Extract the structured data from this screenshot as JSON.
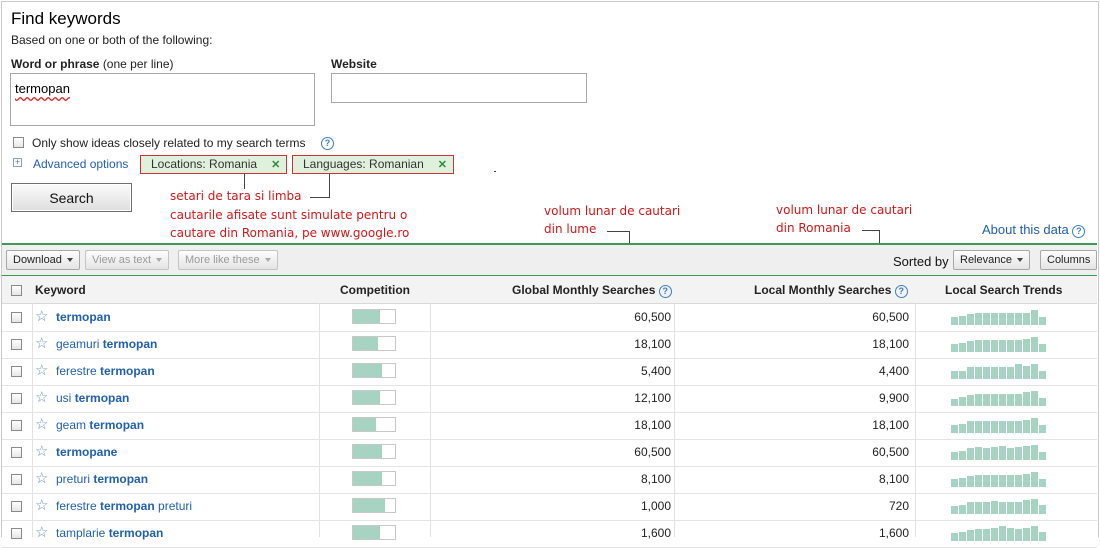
{
  "header": {
    "title": "Find keywords",
    "subtitle": "Based on one or both of the following:",
    "word_label": "Word or phrase",
    "word_hint": "(one per line)",
    "word_value": "termopan",
    "website_label": "Website",
    "website_value": "",
    "only_show_label": "Only show ideas closely related to my search terms",
    "advanced_label": "Advanced options",
    "location_chip": "Locations: Romania",
    "language_chip": "Languages: Romanian",
    "search_label": "Search",
    "about_label": "About this data"
  },
  "annotations": {
    "settings": "setari de tara si limba",
    "simulated_1": "cautarile afisate sunt simulate pentru o",
    "simulated_2": "cautare din Romania, pe www.google.ro",
    "global_1": "volum lunar de cautari",
    "global_2": "din lume",
    "local_1": "volum lunar de cautari",
    "local_2": "din Romania"
  },
  "toolbar": {
    "download": "Download",
    "view_as_text": "View as text",
    "more_like": "More like these",
    "sorted_by": "Sorted by",
    "relevance": "Relevance",
    "columns": "Columns"
  },
  "table": {
    "headers": {
      "keyword": "Keyword",
      "competition": "Competition",
      "global": "Global Monthly Searches",
      "local": "Local Monthly Searches",
      "trends": "Local Search Trends"
    },
    "rows": [
      {
        "pre": "",
        "bold": "termopan",
        "post": "",
        "competition": 0.65,
        "global": "60,500",
        "local": "60,500",
        "trend": [
          0.55,
          0.6,
          0.75,
          0.8,
          0.8,
          0.8,
          0.8,
          0.8,
          0.8,
          0.8,
          1.0,
          0.55
        ]
      },
      {
        "pre": "geamuri ",
        "bold": "termopan",
        "post": "",
        "competition": 0.6,
        "global": "18,100",
        "local": "18,100",
        "trend": [
          0.5,
          0.6,
          0.75,
          0.8,
          0.8,
          0.8,
          0.8,
          0.8,
          0.8,
          0.85,
          1.0,
          0.5
        ]
      },
      {
        "pre": "ferestre ",
        "bold": "termopan",
        "post": "",
        "competition": 0.7,
        "global": "5,400",
        "local": "4,400",
        "trend": [
          0.5,
          0.55,
          0.8,
          0.8,
          0.8,
          0.8,
          0.8,
          0.8,
          1.0,
          0.85,
          1.0,
          0.55
        ]
      },
      {
        "pre": "usi ",
        "bold": "termopan",
        "post": "",
        "competition": 0.65,
        "global": "12,100",
        "local": "9,900",
        "trend": [
          0.45,
          0.6,
          0.75,
          0.8,
          0.8,
          0.8,
          0.8,
          0.8,
          0.8,
          0.9,
          1.0,
          0.5
        ]
      },
      {
        "pre": "geam ",
        "bold": "termopan",
        "post": "",
        "competition": 0.55,
        "global": "18,100",
        "local": "18,100",
        "trend": [
          0.5,
          0.6,
          0.8,
          0.8,
          0.8,
          0.8,
          0.8,
          0.8,
          0.8,
          0.85,
          1.0,
          0.5
        ]
      },
      {
        "pre": "",
        "bold": "termopane",
        "post": "",
        "competition": 0.7,
        "global": "60,500",
        "local": "60,500",
        "trend": [
          0.55,
          0.6,
          0.8,
          0.85,
          0.8,
          0.85,
          0.9,
          0.8,
          0.85,
          0.9,
          1.0,
          0.55
        ]
      },
      {
        "pre": "preturi ",
        "bold": "termopan",
        "post": "",
        "competition": 0.7,
        "global": "8,100",
        "local": "8,100",
        "trend": [
          0.55,
          0.6,
          0.75,
          0.8,
          0.8,
          0.8,
          0.8,
          0.8,
          0.8,
          0.85,
          1.0,
          0.55
        ]
      },
      {
        "pre": "ferestre ",
        "bold": "termopan",
        "post": " preturi",
        "competition": 0.75,
        "global": "1,000",
        "local": "720",
        "trend": [
          0.5,
          0.6,
          0.8,
          0.8,
          0.8,
          0.85,
          0.8,
          0.8,
          0.8,
          0.9,
          1.0,
          0.6
        ]
      },
      {
        "pre": "tamplarie ",
        "bold": "termopan",
        "post": "",
        "competition": 0.65,
        "global": "1,600",
        "local": "1,600",
        "trend": [
          0.5,
          0.6,
          0.75,
          0.8,
          0.8,
          0.85,
          1.0,
          0.85,
          0.8,
          0.85,
          1.0,
          0.6
        ]
      }
    ]
  }
}
